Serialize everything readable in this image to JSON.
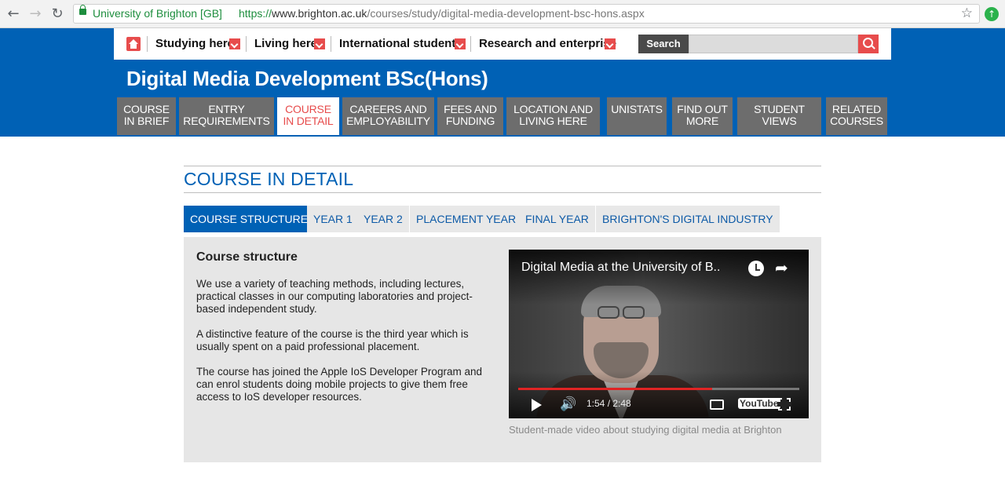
{
  "browser": {
    "org": "University of Brighton [GB]",
    "url_scheme": "https://",
    "url_host": "www.brighton.ac.uk",
    "url_path": "/courses/study/digital-media-development-bsc-hons.aspx"
  },
  "topnav": {
    "items": [
      "Studying here",
      "Living here",
      "International students",
      "Research and enterprise"
    ],
    "search_label": "Search"
  },
  "header": {
    "title": "Digital Media Development BSc(Hons)"
  },
  "tabs": [
    {
      "line1": "COURSE",
      "line2": "IN BRIEF"
    },
    {
      "line1": "ENTRY",
      "line2": "REQUIREMENTS"
    },
    {
      "line1": "COURSE",
      "line2": "IN DETAIL"
    },
    {
      "line1": "CAREERS AND",
      "line2": "EMPLOYABILITY"
    },
    {
      "line1": "FEES AND",
      "line2": "FUNDING"
    },
    {
      "line1": "LOCATION AND",
      "line2": "LIVING HERE"
    },
    {
      "line1": "UNISTATS",
      "line2": ""
    },
    {
      "line1": "FIND OUT",
      "line2": "MORE"
    },
    {
      "line1": "STUDENT",
      "line2": "VIEWS"
    },
    {
      "line1": "RELATED",
      "line2": "COURSES"
    }
  ],
  "active_tab": 2,
  "section": {
    "title": "COURSE IN DETAIL",
    "subtabs": [
      "COURSE STRUCTURE",
      "YEAR 1",
      "YEAR 2",
      "PLACEMENT YEAR",
      "FINAL YEAR",
      "BRIGHTON'S DIGITAL INDUSTRY"
    ],
    "active_subtab": 0
  },
  "panel": {
    "heading": "Course structure",
    "paragraphs": [
      "We use a variety of teaching methods, including lectures, practical classes in our computing laboratories and project-based independent study.",
      "A distinctive feature of the course is the third year which is usually spent on a paid professional placement.",
      "The course has joined the Apple IoS Developer Program and can enrol students doing mobile projects to give them free access to IoS developer resources."
    ]
  },
  "video": {
    "title": "Digital Media at the University of B..",
    "time": "1:54 / 2:48",
    "progress": 0.69,
    "brand": "YouTube",
    "caption": "Student-made video about studying digital media at Brighton"
  },
  "colors": {
    "brand_blue": "#0061b5",
    "accent_red": "#e74c4c",
    "tab_gray": "#6d6d6d"
  }
}
